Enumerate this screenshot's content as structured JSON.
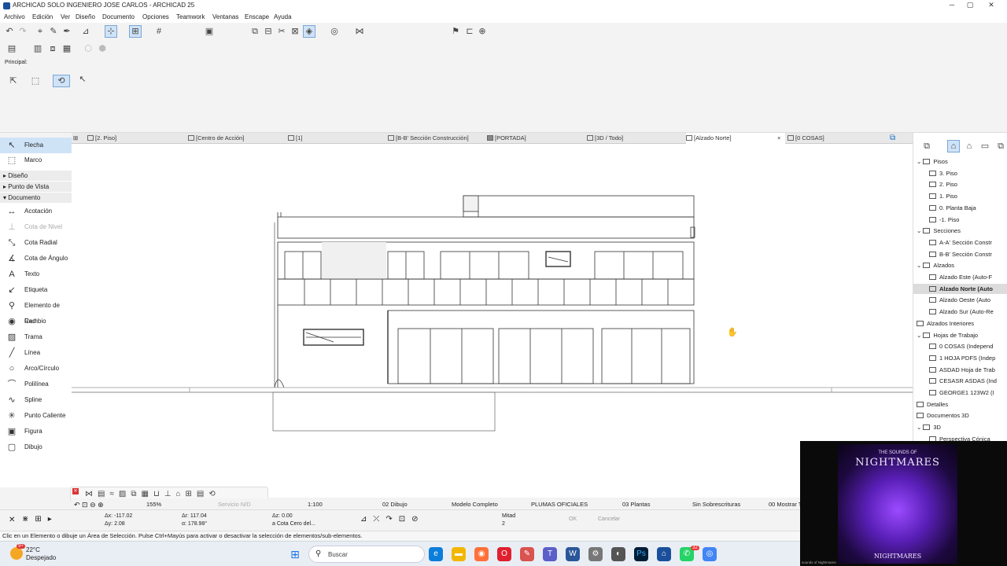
{
  "window": {
    "title": "ARCHICAD SOLO INGENIERO JOSE CARLOS - ARCHICAD 25",
    "controls": [
      "─",
      "▢",
      "✕"
    ]
  },
  "menu": [
    "Archivo",
    "Edición",
    "Ver",
    "Diseño",
    "Documento",
    "Opciones",
    "Teamwork",
    "Ventanas",
    "Enscape",
    "Ayuda"
  ],
  "info_box": {
    "label": "Principal:"
  },
  "tabs": [
    {
      "label": "[2. Piso]"
    },
    {
      "label": "[Centro de Acción]"
    },
    {
      "label": "[1]"
    },
    {
      "label": "[B-B' Sección Construcción]"
    },
    {
      "label": "[PORTADA]"
    },
    {
      "label": "[3D / Todo]"
    },
    {
      "label": "[Alzado Norte]",
      "close": "×"
    },
    {
      "label": "[0 COSAS]"
    }
  ],
  "toolbox": {
    "top": [
      {
        "label": "Flecha",
        "icon": "arrow-icon"
      },
      {
        "label": "Marco",
        "icon": "marquee-icon"
      }
    ],
    "sections": [
      "Diseño",
      "Punto de Vista",
      "Documento"
    ],
    "documento_tools": [
      {
        "label": "Acotación",
        "icon": "dimension-icon"
      },
      {
        "label": "Cota de Nivel",
        "icon": "level-dimension-icon",
        "dim": true
      },
      {
        "label": "Cota Radial",
        "icon": "radial-dimension-icon"
      },
      {
        "label": "Cota de Ángulo",
        "icon": "angle-dimension-icon"
      },
      {
        "label": "Texto",
        "icon": "text-icon"
      },
      {
        "label": "Etiqueta",
        "icon": "label-icon"
      },
      {
        "label": "Elemento de Red",
        "icon": "grid-element-icon"
      },
      {
        "label": "Cambio",
        "icon": "change-icon"
      },
      {
        "label": "Trama",
        "icon": "fill-icon"
      },
      {
        "label": "Línea",
        "icon": "line-icon"
      },
      {
        "label": "Arco/Círculo",
        "icon": "arc-icon"
      },
      {
        "label": "Polilínea",
        "icon": "polyline-icon"
      },
      {
        "label": "Spline",
        "icon": "spline-icon"
      },
      {
        "label": "Punto Caliente",
        "icon": "hotspot-icon"
      },
      {
        "label": "Figura",
        "icon": "figure-icon"
      },
      {
        "label": "Dibujo",
        "icon": "drawing-icon"
      }
    ]
  },
  "navigator": {
    "items": [
      {
        "label": "Pisos",
        "level": 0,
        "folder": true
      },
      {
        "label": "3. Piso",
        "level": 1
      },
      {
        "label": "2. Piso",
        "level": 1
      },
      {
        "label": "1. Piso",
        "level": 1
      },
      {
        "label": "0. Planta Baja",
        "level": 1
      },
      {
        "label": "-1. Piso",
        "level": 1
      },
      {
        "label": "Secciones",
        "level": 0,
        "folder": true
      },
      {
        "label": "A-A' Sección Constr",
        "level": 1
      },
      {
        "label": "B-B' Sección Constr",
        "level": 1
      },
      {
        "label": "Alzados",
        "level": 0,
        "folder": true
      },
      {
        "label": "Alzado Este (Auto-F",
        "level": 1
      },
      {
        "label": "Alzado Norte (Auto",
        "level": 1,
        "selected": true
      },
      {
        "label": "Alzado Oeste (Auto",
        "level": 1
      },
      {
        "label": "Alzado Sur (Auto-Re",
        "level": 1
      },
      {
        "label": "Alzados Interiores",
        "level": 0
      },
      {
        "label": "Hojas de Trabajo",
        "level": 0,
        "folder": true
      },
      {
        "label": "0 COSAS (Independ",
        "level": 1
      },
      {
        "label": "1 HOJA PDFS (Indep",
        "level": 1
      },
      {
        "label": "ASDAD Hoja de Trab",
        "level": 1
      },
      {
        "label": "CESASR ASDAS (Ind",
        "level": 1
      },
      {
        "label": "GEORGE1 123W2 (I",
        "level": 1
      },
      {
        "label": "Detalles",
        "level": 0
      },
      {
        "label": "Documentos 3D",
        "level": 0
      },
      {
        "label": "3D",
        "level": 0,
        "folder": true
      },
      {
        "label": "Perspectiva Cónica",
        "level": 1
      }
    ]
  },
  "status": {
    "zoom": "155%",
    "servicio": "Servicio N/D",
    "scale": "1:100",
    "layer": "02 Dibujo",
    "model": "Modelo Completo",
    "pens": "PLUMAS OFICIALES",
    "planes": "03 Plantas",
    "overrides": "Sin Sobrescrituras",
    "show": "00 Mostrar T"
  },
  "coords": {
    "ax": "Δx: -117.02",
    "ay": "Δy: 2.08",
    "ar": "Δr: 117.04",
    "aa": "α: 178.98°",
    "az": "Δz: 0.00",
    "ref": "a Cota Cero del...",
    "half": "Mitad",
    "half_n": "2",
    "ok": "OK",
    "cancel": "Cancelar"
  },
  "hint": "Clic en un Elemento o dibuje un Área de Selección. Pulse Ctrl+Mayús para activar o desactivar la selección de elementos/sub-elementos.",
  "taskbar": {
    "weather_temp": "22°C",
    "weather_desc": "Despejado",
    "search_placeholder": "Buscar",
    "badge": "9+",
    "wa_badge": "32"
  },
  "video": {
    "line1": "THE SOUNDS OF",
    "line2": "NIGHTMARES",
    "line3": "NIGHTMARES",
    "caption": "sounds of Nightmares"
  }
}
